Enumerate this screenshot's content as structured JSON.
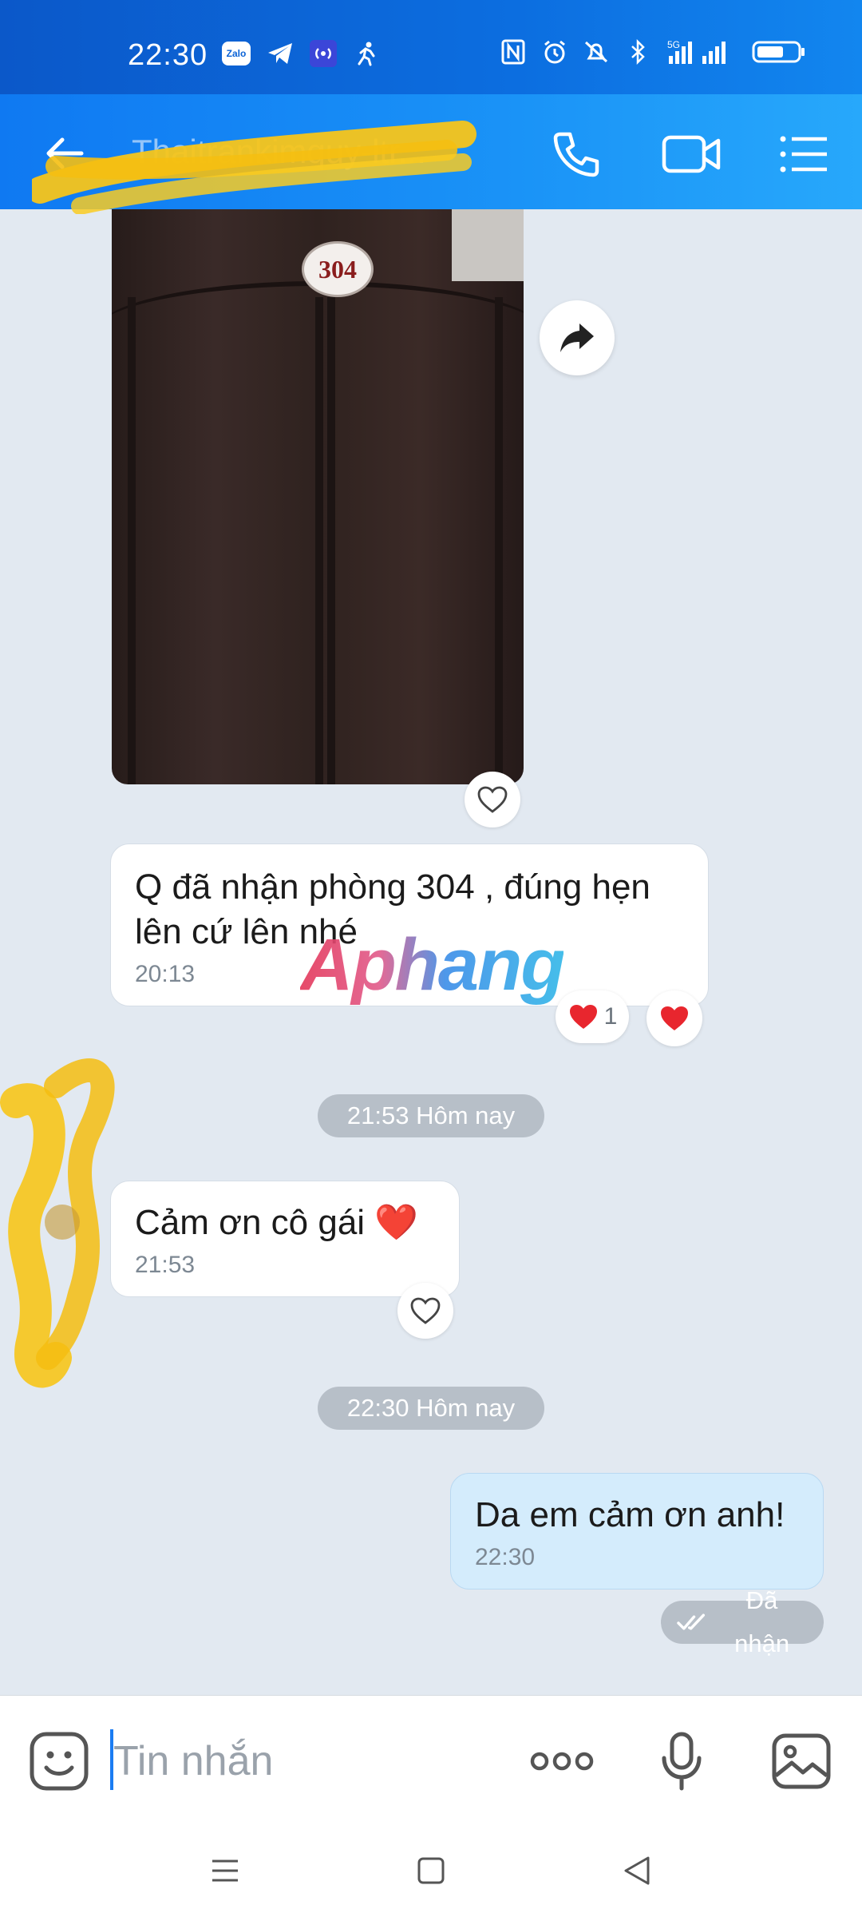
{
  "status_bar": {
    "time": "22:30",
    "left_icons": [
      "zalo-icon",
      "telegram-icon",
      "hotspot-icon",
      "running-icon"
    ],
    "zalo_label": "Zalo",
    "network_label": "5G",
    "right_icons": [
      "nfc-icon",
      "alarm-icon",
      "mute-icon",
      "bluetooth-icon",
      "signal-icon",
      "battery-icon"
    ]
  },
  "header": {
    "contact_name": "Thaitrankimquy-ltr...",
    "icons": [
      "back-arrow-icon",
      "phone-icon",
      "video-call-icon",
      "menu-list-icon"
    ]
  },
  "messages": {
    "photo": {
      "room_number": "304"
    },
    "msg1": {
      "text": "Q đã nhận phòng 304 , đúng hẹn lên cứ lên nhé",
      "time": "20:13",
      "reaction_count": "1"
    },
    "divider1": "21:53 Hôm nay",
    "msg2": {
      "text": "Cảm ơn cô gái ❤️",
      "time": "21:53"
    },
    "divider2": "22:30 Hôm nay",
    "msg3": {
      "text": "Da em cảm ơn anh!",
      "time": "22:30",
      "status": "Đã nhận"
    }
  },
  "watermark": "Aphang",
  "input_bar": {
    "placeholder": "Tin nhắn",
    "icons": [
      "emoji-icon",
      "more-dots-icon",
      "microphone-icon",
      "image-icon"
    ]
  },
  "nav_bar": {
    "icons": [
      "recent-apps-icon",
      "home-icon",
      "back-icon"
    ]
  },
  "colors": {
    "header_blue": "#1a93f7",
    "chat_background": "#e2e9f1",
    "outgoing_bubble": "#d4ecfc",
    "heart_red": "#e8262e",
    "divider_pill": "#b7bfc8"
  }
}
